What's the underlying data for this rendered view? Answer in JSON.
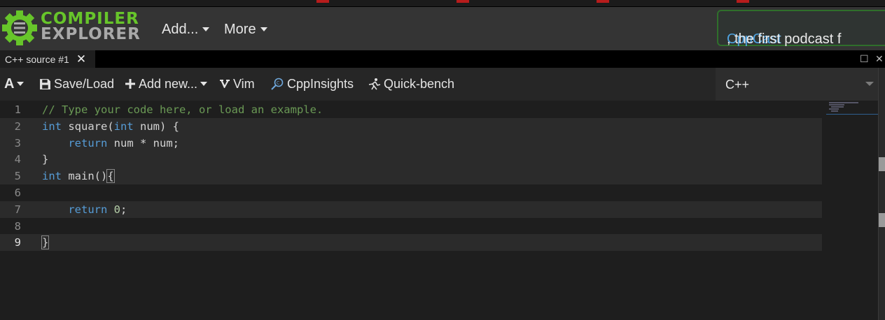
{
  "navbar": {
    "logo_line1": "COMPILER",
    "logo_line2": "EXPLORER",
    "add_label": "Add...",
    "more_label": "More",
    "podcast_link": "CppCast",
    "podcast_rest": ", the first podcast f"
  },
  "tab": {
    "title": "C++ source #1",
    "close": "✕",
    "maximize": "☐",
    "close_pane": "✕"
  },
  "toolbar": {
    "font_label": "A",
    "save_load": "Save/Load",
    "add_new": "Add new...",
    "vim": "Vim",
    "cppinsights": "CppInsights",
    "quickbench": "Quick-bench",
    "language": "C++"
  },
  "editor": {
    "line_numbers": [
      "1",
      "2",
      "3",
      "4",
      "5",
      "6",
      "7",
      "8",
      "9"
    ],
    "lines": [
      "// Type your code here, or load an example.",
      "int square(int num) {",
      "    return num * num;",
      "}",
      "int main(){",
      "",
      "    return 0;",
      "",
      "}"
    ]
  },
  "colors": {
    "accent_green": "#67c52a",
    "link_blue": "#4fa3e0",
    "keyword": "#569cd6",
    "comment": "#6a9955"
  }
}
